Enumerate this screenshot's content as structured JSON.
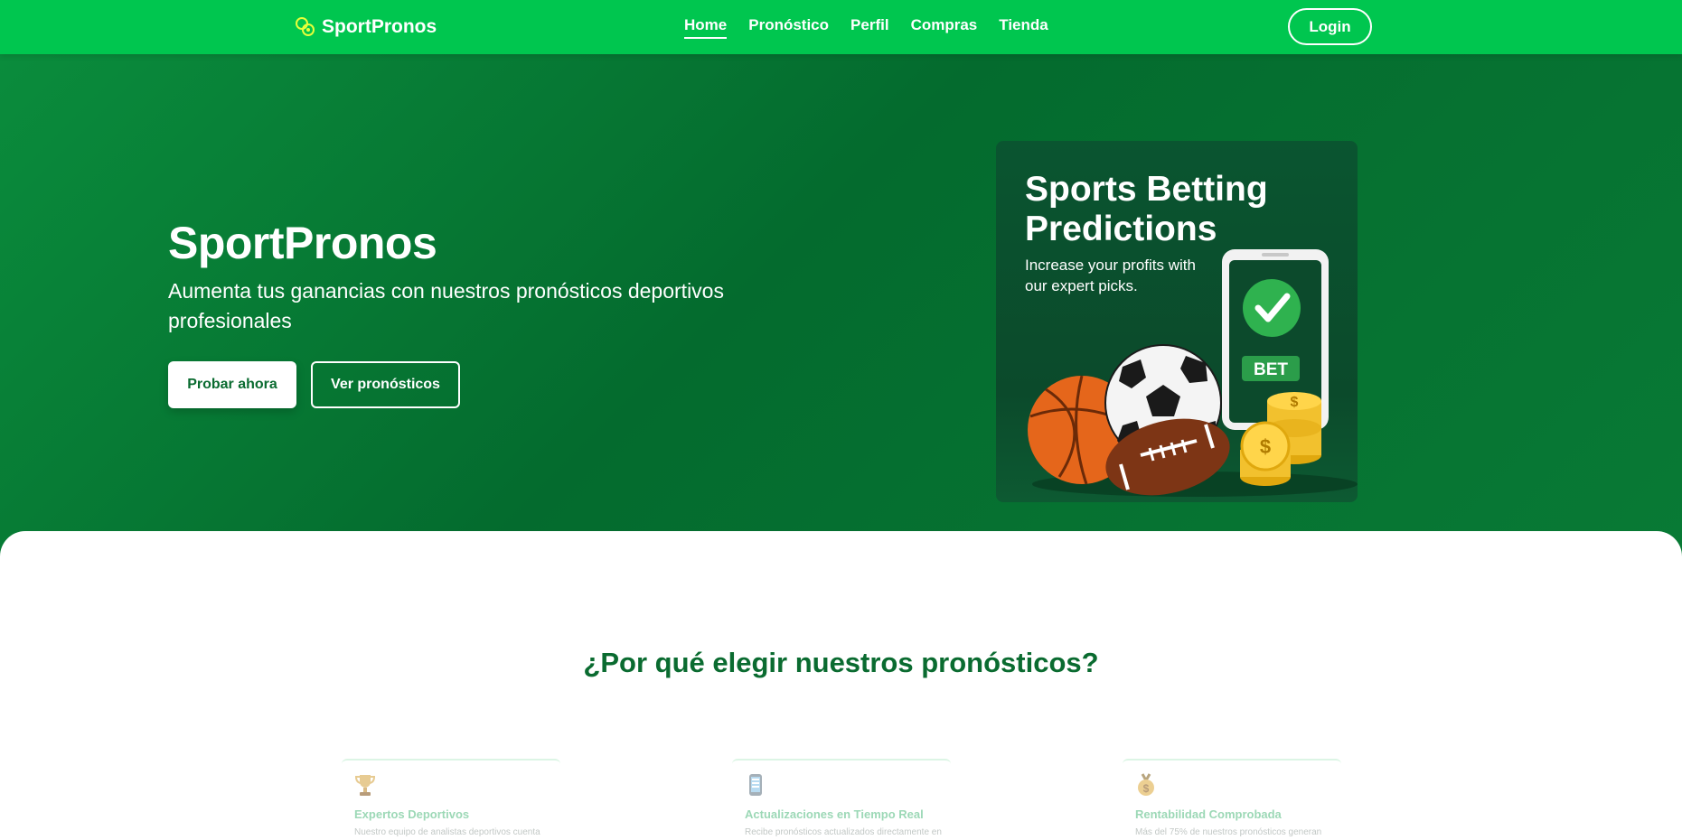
{
  "navbar": {
    "brand": "SportPronos",
    "links": [
      {
        "label": "Home",
        "active": true
      },
      {
        "label": "Pronóstico",
        "active": false
      },
      {
        "label": "Perfil",
        "active": false
      },
      {
        "label": "Compras",
        "active": false
      },
      {
        "label": "Tienda",
        "active": false
      }
    ],
    "login_label": "Login",
    "color": "#00c64f"
  },
  "hero": {
    "title": "SportPronos",
    "subtitle": "Aumenta tus ganancias con nuestros pronósticos deportivos profesionales",
    "primary_button": "Probar ahora",
    "secondary_button": "Ver pronósticos",
    "promo": {
      "title": "Sports Betting Predictions",
      "subtitle": "Increase your profits with our expert picks.",
      "phone_badge": "BET",
      "coin_symbol": "$"
    }
  },
  "features": {
    "title": "¿Por qué elegir nuestros pronósticos?",
    "items": [
      {
        "icon": "trophy-icon",
        "title": "Expertos Deportivos",
        "description": "Nuestro equipo de analistas deportivos cuenta"
      },
      {
        "icon": "phone-icon",
        "title": "Actualizaciones en Tiempo Real",
        "description": "Recibe pronósticos actualizados directamente en"
      },
      {
        "icon": "medal-icon",
        "title": "Rentabilidad Comprobada",
        "description": "Más del 75% de nuestros pronósticos generan"
      }
    ]
  },
  "colors": {
    "primary": "#00c64f",
    "hero_dark": "#046b2e",
    "heading": "#0a6b30"
  }
}
